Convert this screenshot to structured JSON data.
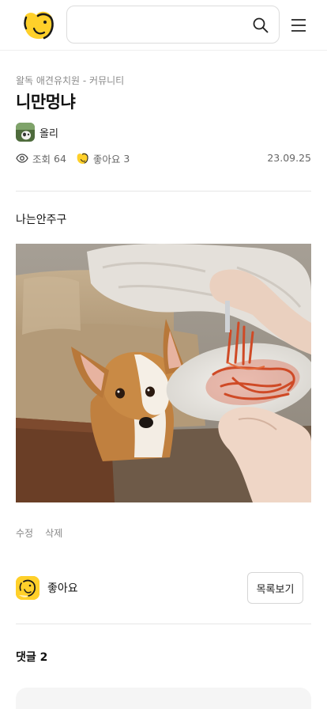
{
  "header": {
    "search": {
      "value": "",
      "placeholder": ""
    },
    "icons": {
      "logo": "dog-face-logo",
      "search": "search-icon",
      "menu": "hamburger-menu-icon"
    }
  },
  "post": {
    "breadcrumb": "왈독 애견유치원 - 커뮤니티",
    "title": "니만멍냐",
    "author": "올리",
    "views_label": "조회",
    "views": "64",
    "likes_label": "좋아요",
    "likes": "3",
    "date": "23.09.25",
    "body": "나는안주구",
    "image_alt": "corgi looking at a plate of pasta",
    "edit_label": "수정",
    "delete_label": "삭제"
  },
  "actions": {
    "like_label": "좋아요",
    "list_label": "목록보기"
  },
  "comments": {
    "heading": "댓글",
    "count": "2"
  },
  "colors": {
    "brand_yellow": "#ffd02a",
    "divider": "#e6e6e6",
    "muted_text": "#888888"
  }
}
